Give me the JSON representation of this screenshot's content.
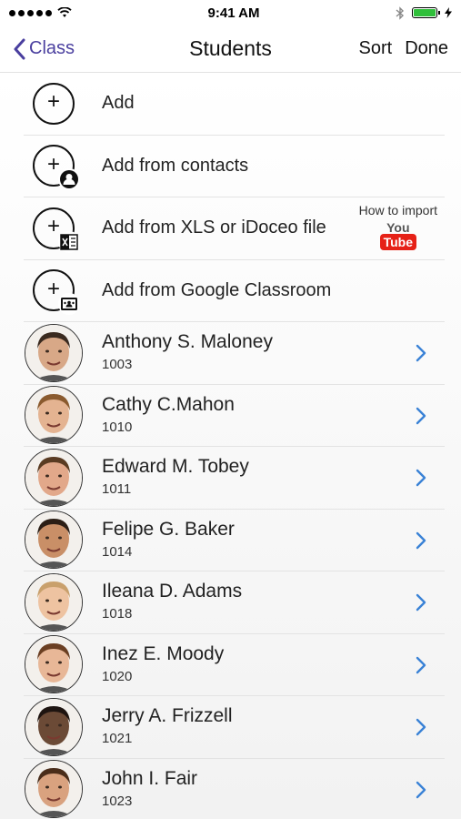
{
  "status_bar": {
    "time": "9:41 AM"
  },
  "nav": {
    "back_label": "Class",
    "title": "Students",
    "sort_label": "Sort",
    "done_label": "Done"
  },
  "add_actions": [
    {
      "label": "Add",
      "icon": "add-icon"
    },
    {
      "label": "Add from contacts",
      "icon": "add-contact-icon"
    },
    {
      "label": "Add from XLS or iDoceo file",
      "icon": "add-xls-icon"
    },
    {
      "label": "Add from Google Classroom",
      "icon": "add-google-classroom-icon"
    }
  ],
  "howto": {
    "label": "How to import",
    "youtube_you": "You",
    "youtube_tube": "Tube"
  },
  "students": [
    {
      "name": "Anthony S. Maloney",
      "id": "1003",
      "tone": "#d8a887",
      "hair": "#3a2a1f"
    },
    {
      "name": "Cathy C.Mahon",
      "id": "1010",
      "tone": "#e4b391",
      "hair": "#8a5a2e"
    },
    {
      "name": "Edward M. Tobey",
      "id": "1011",
      "tone": "#e2a88a",
      "hair": "#5a3b22"
    },
    {
      "name": "Felipe G. Baker",
      "id": "1014",
      "tone": "#c98f67",
      "hair": "#2b1e15"
    },
    {
      "name": "Ileana D. Adams",
      "id": "1018",
      "tone": "#eec3a1",
      "hair": "#c9a06c"
    },
    {
      "name": "Inez E. Moody",
      "id": "1020",
      "tone": "#e8b797",
      "hair": "#6b3f22"
    },
    {
      "name": "Jerry A. Frizzell",
      "id": "1021",
      "tone": "#6b4a36",
      "hair": "#1e1410"
    },
    {
      "name": "John I.  Fair",
      "id": "1023",
      "tone": "#d9a27f",
      "hair": "#4a2d1a"
    }
  ],
  "colors": {
    "accent": "#4a3f9f",
    "chevron": "#3a82d6",
    "youtube_red": "#e62117",
    "battery_green": "#2fbf3a"
  }
}
